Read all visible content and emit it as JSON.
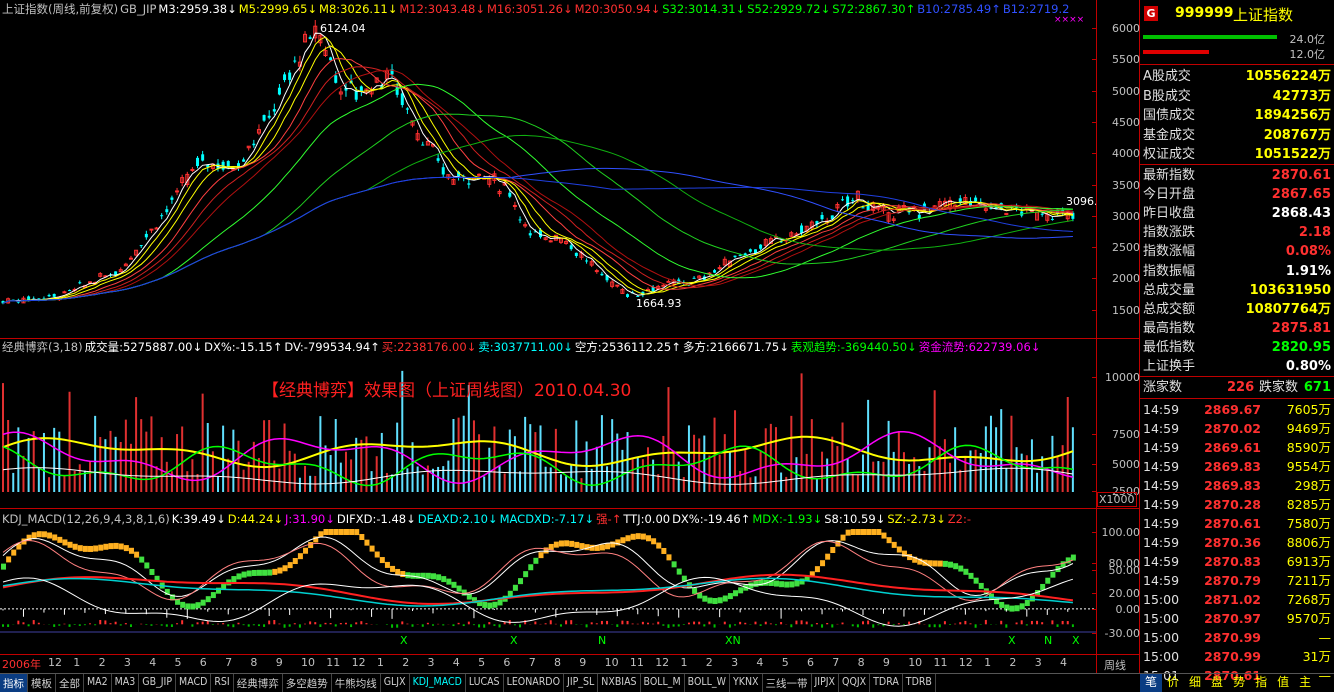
{
  "main_header": [
    {
      "text": "上证指数(周线,前复权)",
      "color": "#c0c0c0"
    },
    {
      "text": "GB_JIP",
      "color": "#c0c0c0"
    },
    {
      "text": "M3:2959.38↓",
      "color": "#ffffff"
    },
    {
      "text": "M5:2999.65↓",
      "color": "#ffff00"
    },
    {
      "text": "M8:3026.11↓",
      "color": "#ffff00"
    },
    {
      "text": "M12:3043.48↓",
      "color": "#ff3030"
    },
    {
      "text": "M16:3051.26↓",
      "color": "#ff3030"
    },
    {
      "text": "M20:3050.94↓",
      "color": "#ff3030"
    },
    {
      "text": "S32:3014.31↓",
      "color": "#00ff00"
    },
    {
      "text": "S52:2929.72↓",
      "color": "#00ff00"
    },
    {
      "text": "S72:2867.30↑",
      "color": "#00ff00"
    },
    {
      "text": "B10:2785.49↑",
      "color": "#3050ff"
    },
    {
      "text": "B12:2719.2",
      "color": "#3050ff"
    }
  ],
  "main_marks": {
    "high": "6124.04",
    "low": "1664.93",
    "current": "3096.",
    "xxxx": "××××"
  },
  "price_ticks": [
    "6000",
    "5500",
    "5000",
    "4500",
    "4000",
    "3500",
    "3000",
    "2500",
    "2000",
    "1500"
  ],
  "mid_header": [
    {
      "text": "经典博弈(3,18)",
      "color": "#c0c0c0"
    },
    {
      "text": "成交量:5275887.00↓",
      "color": "#ffffff"
    },
    {
      "text": "DX%:-15.15↑",
      "color": "#ffffff"
    },
    {
      "text": "DV:-799534.94↑",
      "color": "#ffffff"
    },
    {
      "text": "买:2238176.00↓",
      "color": "#ff3030"
    },
    {
      "text": "卖:3037711.00↓",
      "color": "#00ffff"
    },
    {
      "text": "空方:2536112.25↑",
      "color": "#ffffff"
    },
    {
      "text": "多方:2166671.75↓",
      "color": "#ffffff"
    },
    {
      "text": "表观趋势:-369440.50↓",
      "color": "#00ff00"
    },
    {
      "text": "资金流势:622739.06↓",
      "color": "#ff00ff"
    }
  ],
  "mid_title": "【经典博弈】效果图（上证周线图）2010.04.30",
  "mid_ticks": [
    "10000",
    "7500",
    "5000",
    "2500"
  ],
  "mid_unit": "X1000",
  "bot_header": [
    {
      "text": "KDJ_MACD(12,26,9,4,3,8,1,6)",
      "color": "#c0c0c0"
    },
    {
      "text": "K:39.49↓",
      "color": "#ffffff"
    },
    {
      "text": "D:44.24↓",
      "color": "#ffff00"
    },
    {
      "text": "J:31.90↓",
      "color": "#ff00ff"
    },
    {
      "text": "DIFXD:-1.48↓",
      "color": "#ffffff"
    },
    {
      "text": "DEAXD:2.10↓",
      "color": "#00ffff"
    },
    {
      "text": "MACDXD:-7.17↓",
      "color": "#00ffff"
    },
    {
      "text": "强-↑",
      "color": "#ff3030"
    },
    {
      "text": "TTJ:0.00",
      "color": "#ffffff"
    },
    {
      "text": "DX%:-19.46↑",
      "color": "#ffffff"
    },
    {
      "text": "MDX:-1.93↓",
      "color": "#00ff00"
    },
    {
      "text": "S8:10.59↓",
      "color": "#ffffff"
    },
    {
      "text": "SZ:-2.73↓",
      "color": "#ffff00"
    },
    {
      "text": "Z2:-",
      "color": "#ff3030"
    }
  ],
  "bot_ticks": [
    "100.00",
    "80.00",
    "50.00",
    "20.00",
    "0.00",
    "-30.00"
  ],
  "bot_marks": [
    "X",
    "X",
    "N",
    "XN",
    "X",
    "N",
    "X"
  ],
  "months": [
    "2006年",
    "12",
    "1",
    "2",
    "3",
    "4",
    "5",
    "6",
    "7",
    "8",
    "9",
    "10",
    "11",
    "12",
    "1",
    "2",
    "3",
    "4",
    "5",
    "6",
    "7",
    "8",
    "9",
    "10",
    "11",
    "12",
    "1",
    "2",
    "3",
    "4",
    "5",
    "6",
    "7",
    "8",
    "9",
    "10",
    "11",
    "12",
    "1",
    "2",
    "3",
    "4"
  ],
  "period_label": "周线",
  "tabs": [
    "指标",
    "模板",
    "全部",
    "MA2",
    "MA3",
    "GB_JIP",
    "MACD",
    "RSI",
    "经典博弈",
    "多空趋势",
    "牛熊均线",
    "GLJX",
    "KDJ_MACD",
    "LUCAS",
    "LEONARDO",
    "JIP_SL",
    "NXBIAS",
    "BOLL_M",
    "BOLL_W",
    "YKNX",
    "三线一带",
    "JIPJX",
    "QQJX",
    "TDRA",
    "TDRB"
  ],
  "active_tab": "指标",
  "cyan_tab": "KDJ_MACD",
  "quote": {
    "code": "999999",
    "name": "上证指数",
    "badge": "G",
    "bar_labels": [
      "24.0亿",
      "12.0亿"
    ],
    "volume_rows": [
      {
        "label": "A股成交",
        "value": "10556224万"
      },
      {
        "label": "B股成交",
        "value": "42773万"
      },
      {
        "label": "国债成交",
        "value": "1894256万"
      },
      {
        "label": "基金成交",
        "value": "208767万"
      },
      {
        "label": "权证成交",
        "value": "1051522万"
      }
    ],
    "index_rows": [
      {
        "label": "最新指数",
        "value": "2870.61",
        "color": "#ff3030"
      },
      {
        "label": "今日开盘",
        "value": "2867.65",
        "color": "#ff3030"
      },
      {
        "label": "昨日收盘",
        "value": "2868.43",
        "color": "#ffffff"
      },
      {
        "label": "指数涨跌",
        "value": "2.18",
        "color": "#ff3030"
      },
      {
        "label": "指数涨幅",
        "value": "0.08%",
        "color": "#ff3030"
      },
      {
        "label": "指数振幅",
        "value": "1.91%",
        "color": "#ffffff"
      },
      {
        "label": "总成交量",
        "value": "103631950",
        "color": "#ffff00"
      },
      {
        "label": "总成交额",
        "value": "10807764万",
        "color": "#ffff00"
      },
      {
        "label": "最高指数",
        "value": "2875.81",
        "color": "#ff3030"
      },
      {
        "label": "最低指数",
        "value": "2820.95",
        "color": "#00ff00"
      },
      {
        "label": "上证换手",
        "value": "0.80%",
        "color": "#ffffff"
      }
    ],
    "rise_label": "涨家数",
    "rise_value": "226",
    "fall_label": "跌家数",
    "fall_value": "671",
    "ticks": [
      {
        "time": "14:59",
        "price": "2869.67",
        "color": "#ff3030",
        "vol": "7605万"
      },
      {
        "time": "14:59",
        "price": "2870.02",
        "color": "#ff3030",
        "vol": "9469万"
      },
      {
        "time": "14:59",
        "price": "2869.61",
        "color": "#ff3030",
        "vol": "8590万"
      },
      {
        "time": "14:59",
        "price": "2869.83",
        "color": "#ff3030",
        "vol": "9554万"
      },
      {
        "time": "14:59",
        "price": "2869.83",
        "color": "#ff3030",
        "vol": "298万"
      },
      {
        "time": "14:59",
        "price": "2870.28",
        "color": "#ff3030",
        "vol": "8285万"
      },
      {
        "time": "14:59",
        "price": "2870.61",
        "color": "#ff3030",
        "vol": "7580万"
      },
      {
        "time": "14:59",
        "price": "2870.36",
        "color": "#ff3030",
        "vol": "8806万"
      },
      {
        "time": "14:59",
        "price": "2870.83",
        "color": "#ff3030",
        "vol": "6913万"
      },
      {
        "time": "14:59",
        "price": "2870.79",
        "color": "#ff3030",
        "vol": "7211万"
      },
      {
        "time": "15:00",
        "price": "2871.02",
        "color": "#ff3030",
        "vol": "7268万"
      },
      {
        "time": "15:00",
        "price": "2870.97",
        "color": "#ff3030",
        "vol": "9570万"
      },
      {
        "time": "15:00",
        "price": "2870.99",
        "color": "#ff3030",
        "vol": "—"
      },
      {
        "time": "15:00",
        "price": "2870.99",
        "color": "#ff3030",
        "vol": "31万"
      },
      {
        "time": "15:01",
        "price": "2870.61",
        "color": "#ff3030",
        "vol": "—"
      }
    ],
    "bottom_tabs": [
      "笔",
      "价",
      "细",
      "盘",
      "势",
      "指",
      "值",
      "主"
    ]
  }
}
